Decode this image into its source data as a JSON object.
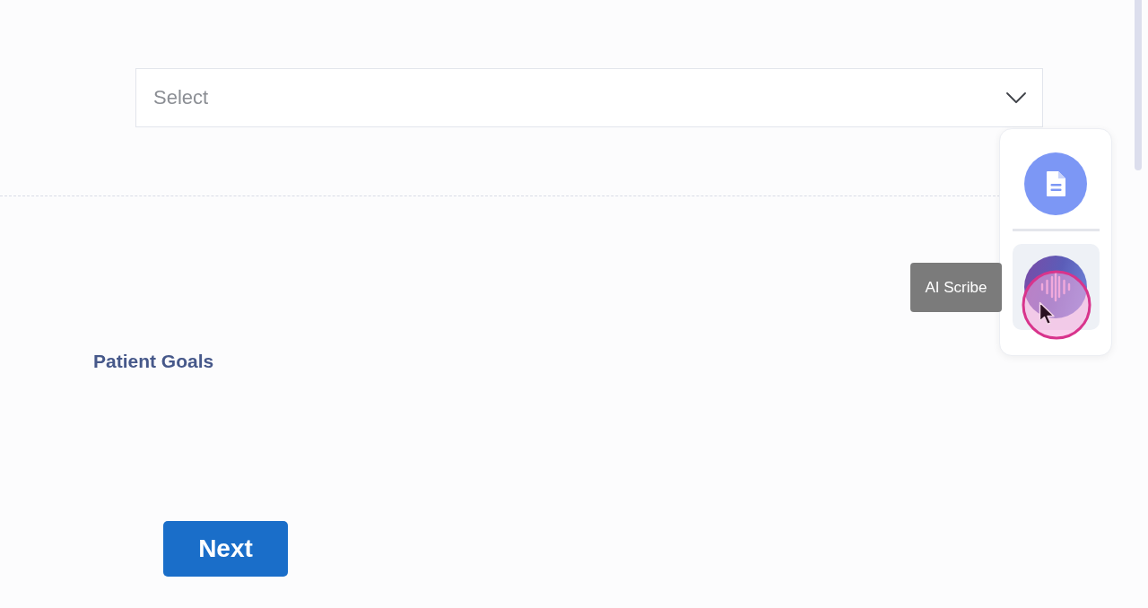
{
  "select": {
    "placeholder": "Select"
  },
  "side_panel": {
    "buttons": [
      {
        "kind": "document",
        "selected": false
      },
      {
        "kind": "scribe",
        "selected": true
      }
    ],
    "tooltip": "AI Scribe"
  },
  "section": {
    "title": "Patient Goals"
  },
  "buttons": [
    {
      "label": "Next"
    }
  ]
}
